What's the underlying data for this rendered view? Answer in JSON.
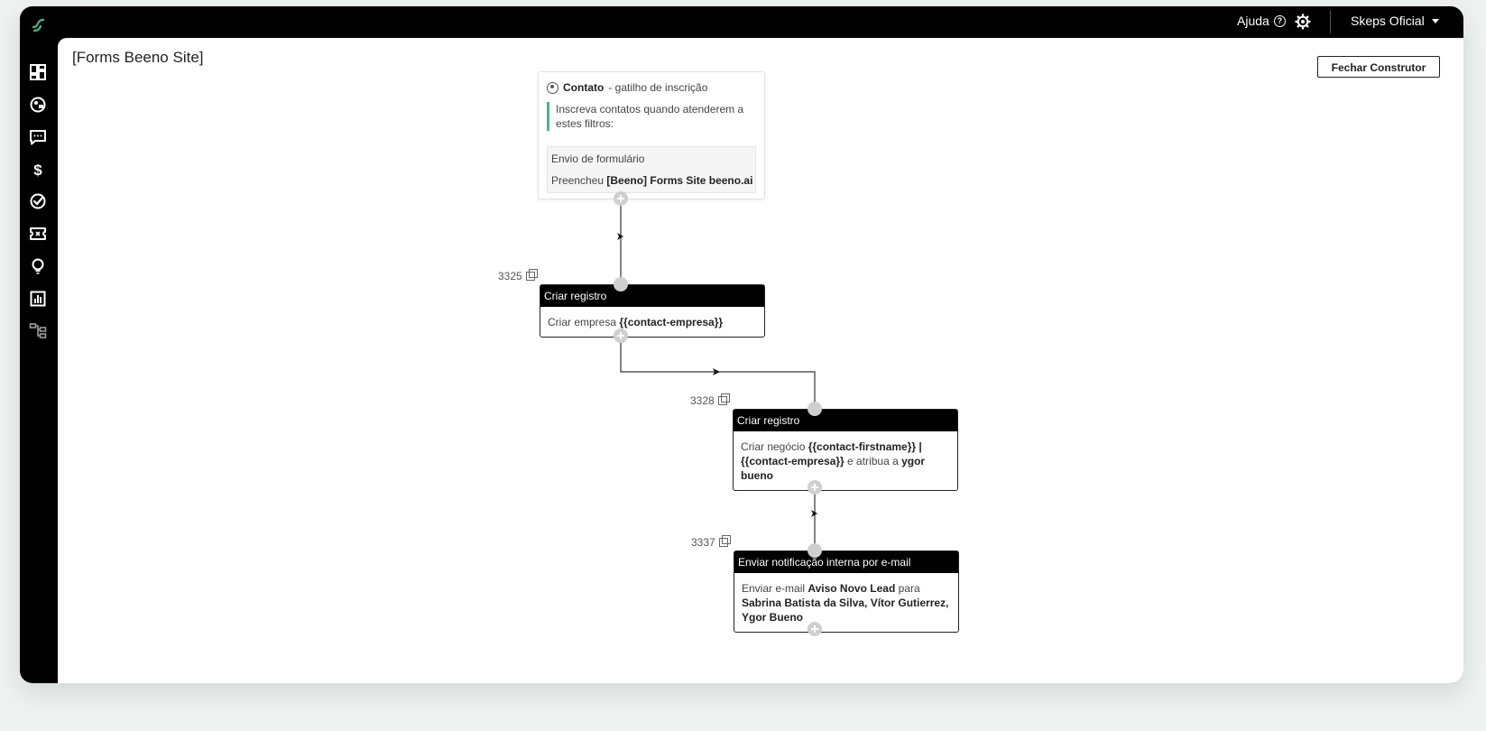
{
  "topbar": {
    "help_label": "Ajuda",
    "help_glyph": "?",
    "account_label": "Skeps Oficial"
  },
  "sidebar": {
    "items": [
      {
        "name": "dashboard-icon"
      },
      {
        "name": "contacts-icon"
      },
      {
        "name": "chat-icon"
      },
      {
        "name": "dollar-icon",
        "glyph": "$"
      },
      {
        "name": "tasks-check-icon"
      },
      {
        "name": "ticket-icon"
      },
      {
        "name": "lightbulb-icon"
      },
      {
        "name": "reports-icon"
      },
      {
        "name": "workflow-icon"
      }
    ]
  },
  "page": {
    "title": "[Forms Beeno Site]",
    "close_button": "Fechar Construtor"
  },
  "trigger": {
    "object": "Contato",
    "suffix": "- gatilho de inscrição",
    "description": "Inscreva contatos quando atenderem a estes filtros:",
    "filter_type": "Envio de formulário",
    "filter_prefix": "Preencheu",
    "filter_value": "[Beeno] Forms Site beeno.ai"
  },
  "nodes": [
    {
      "id": "3325",
      "title": "Criar registro",
      "body": [
        {
          "text": "Criar empresa ",
          "bold": false
        },
        {
          "text": "{{contact-empresa}}",
          "bold": true
        }
      ]
    },
    {
      "id": "3328",
      "title": "Criar registro",
      "body": [
        {
          "text": "Criar negócio ",
          "bold": false
        },
        {
          "text": "{{contact-firstname}} | {{contact-empresa}}",
          "bold": true
        },
        {
          "text": " e atribua a ",
          "bold": false
        },
        {
          "text": "ygor bueno",
          "bold": true
        }
      ]
    },
    {
      "id": "3337",
      "title": "Enviar notificação interna por e-mail",
      "body": [
        {
          "text": "Enviar e-mail ",
          "bold": false
        },
        {
          "text": "Aviso Novo Lead",
          "bold": true
        },
        {
          "text": " para ",
          "bold": false
        },
        {
          "text": "Sabrina Batista da Silva, Vítor Gutierrez, Ygor Bueno",
          "bold": true
        }
      ]
    }
  ],
  "colors": {
    "chrome": "#000000",
    "accent_green": "#4cb38a",
    "port": "#cfcfcf",
    "background": "#eef3f1"
  }
}
